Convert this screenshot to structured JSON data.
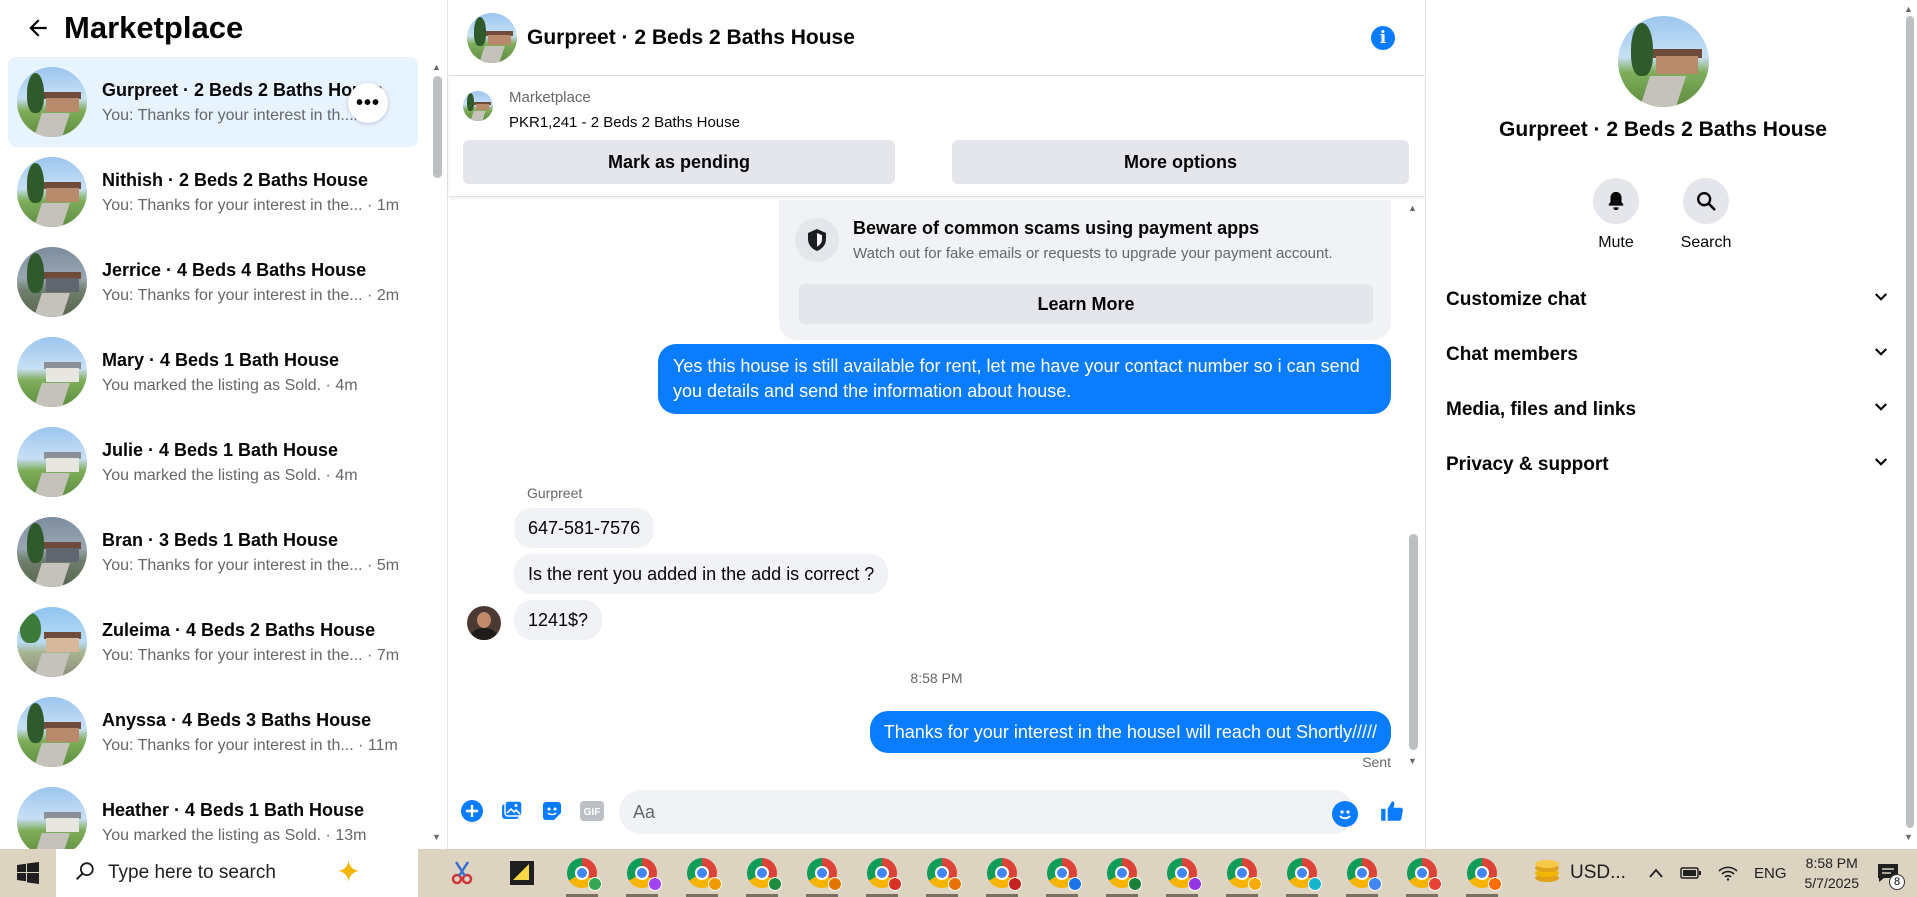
{
  "sidebar": {
    "title": "Marketplace",
    "conversations": [
      {
        "name": "Gurpreet · 2 Beds 2 Baths House",
        "preview": "You: Thanks for your interest in th...m",
        "active": true
      },
      {
        "name": "Nithish · 2 Beds 2 Baths House",
        "preview": "You: Thanks for your interest in the... · 1m"
      },
      {
        "name": "Jerrice · 4 Beds 4 Baths House",
        "preview": "You: Thanks for your interest in the... · 2m"
      },
      {
        "name": "Mary · 4 Beds 1 Bath House",
        "preview": "You marked the listing as Sold. · 4m"
      },
      {
        "name": "Julie · 4 Beds 1 Bath House",
        "preview": "You marked the listing as Sold. · 4m"
      },
      {
        "name": "Bran · 3 Beds 1 Bath House",
        "preview": "You: Thanks for your interest in the... · 5m"
      },
      {
        "name": "Zuleima · 4 Beds 2 Baths House",
        "preview": "You: Thanks for your interest in the... · 7m"
      },
      {
        "name": "Anyssa · 4 Beds 3 Baths House",
        "preview": "You: Thanks for your interest in th... · 11m"
      },
      {
        "name": "Heather · 4 Beds 1 Bath House",
        "preview": "You marked the listing as Sold. · 13m"
      }
    ],
    "more_label": "•••"
  },
  "chat": {
    "title": "Gurpreet · 2 Beds 2 Baths House",
    "info_label": "i",
    "listing": {
      "kind": "Marketplace",
      "price_line": "PKR1,241 - 2 Beds 2 Baths House",
      "pending_label": "Mark as pending",
      "more_label": "More options"
    },
    "scam_card": {
      "title": "Beware of common scams using payment apps",
      "description": "Watch out for fake emails or requests to upgrade your payment account.",
      "button": "Learn More"
    },
    "messages": {
      "out_1": "Yes this house is still available for rent, let me have your contact number so i can send you details and send the information about house.",
      "sender": "Gurpreet",
      "in_1": "647-581-7576",
      "in_2": "Is the rent you added in the add is correct ?",
      "in_3": "1241$?",
      "timestamp": "8:58 PM",
      "out_2": "Thanks for your interest in the houseI will reach out Shortly/////",
      "status": "Sent"
    },
    "composer": {
      "placeholder": "Aa"
    }
  },
  "details": {
    "title": "Gurpreet · 2 Beds 2 Baths House",
    "actions": {
      "mute": "Mute",
      "search": "Search"
    },
    "sections": [
      "Customize chat",
      "Chat members",
      "Media, files and links",
      "Privacy & support"
    ]
  },
  "taskbar": {
    "search_placeholder": "Type here to search",
    "weather": "USD...",
    "language": "ENG",
    "time": "8:58 PM",
    "date": "5/7/2025",
    "notification_count": "8"
  },
  "colors": {
    "accent": "#0a7cff",
    "active_row": "#e7f3ff",
    "bubble_in": "#f0f2f5",
    "taskbar": "#dcd3c1"
  }
}
